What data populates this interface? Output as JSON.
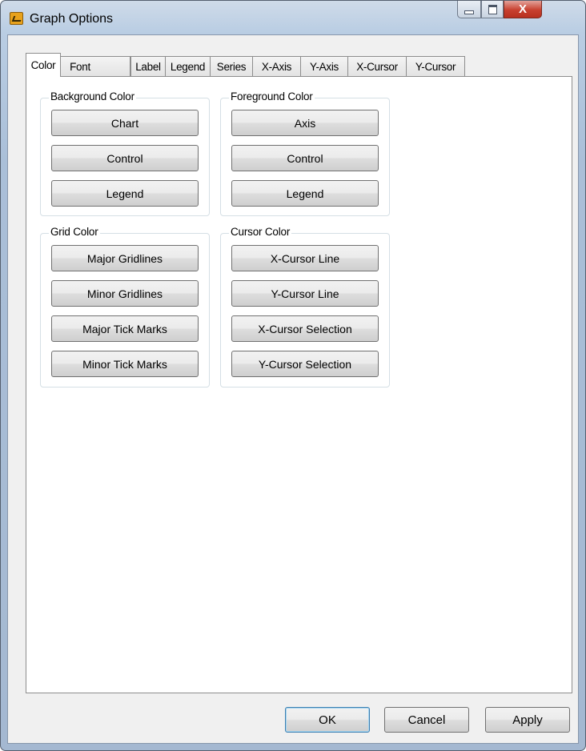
{
  "window": {
    "title": "Graph Options",
    "close_glyph": "X"
  },
  "tabs": [
    {
      "label": "Color",
      "active": true
    },
    {
      "label": "Font",
      "active": false
    },
    {
      "label": "Label",
      "active": false
    },
    {
      "label": "Legend",
      "active": false
    },
    {
      "label": "Series",
      "active": false
    },
    {
      "label": "X-Axis",
      "active": false
    },
    {
      "label": "Y-Axis",
      "active": false
    },
    {
      "label": "X-Cursor",
      "active": false
    },
    {
      "label": "Y-Cursor",
      "active": false
    }
  ],
  "groups": {
    "background": {
      "label": "Background Color",
      "buttons": [
        "Chart",
        "Control",
        "Legend"
      ]
    },
    "foreground": {
      "label": "Foreground Color",
      "buttons": [
        "Axis",
        "Control",
        "Legend"
      ]
    },
    "grid": {
      "label": "Grid Color",
      "buttons": [
        "Major Gridlines",
        "Minor Gridlines",
        "Major Tick Marks",
        "Minor Tick Marks"
      ]
    },
    "cursor": {
      "label": "Cursor Color",
      "buttons": [
        "X-Cursor Line",
        "Y-Cursor Line",
        "X-Cursor Selection",
        "Y-Cursor Selection"
      ]
    }
  },
  "footer": {
    "ok": "OK",
    "cancel": "Cancel",
    "apply": "Apply"
  },
  "colors": {
    "accent": "#3c7fb1",
    "close_button": "#c8402f"
  }
}
